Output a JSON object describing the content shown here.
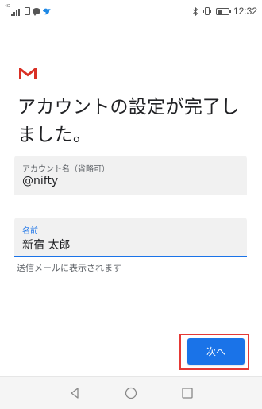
{
  "status_bar": {
    "time": "12:32",
    "signal_tag": "4G",
    "icons": [
      "signal-icon",
      "sim-icon",
      "chat-icon",
      "bird-icon",
      "bluetooth-icon",
      "vibrate-icon",
      "battery-icon"
    ]
  },
  "app": {
    "logo": "gmail-logo"
  },
  "heading": {
    "text": "アカウントの設定が完了しました。"
  },
  "form": {
    "account_name": {
      "label": "アカウント名（省略可）",
      "value": "@nifty"
    },
    "your_name": {
      "label": "名前",
      "value": "新宿 太郎",
      "helper": "送信メールに表示されます"
    }
  },
  "actions": {
    "next_label": "次へ"
  },
  "nav_bar": {
    "icons": [
      "back-icon",
      "home-icon",
      "recent-apps-icon"
    ]
  },
  "colors": {
    "accent": "#1a73e8",
    "highlight": "#e53935",
    "gmail_red": "#d93025"
  }
}
